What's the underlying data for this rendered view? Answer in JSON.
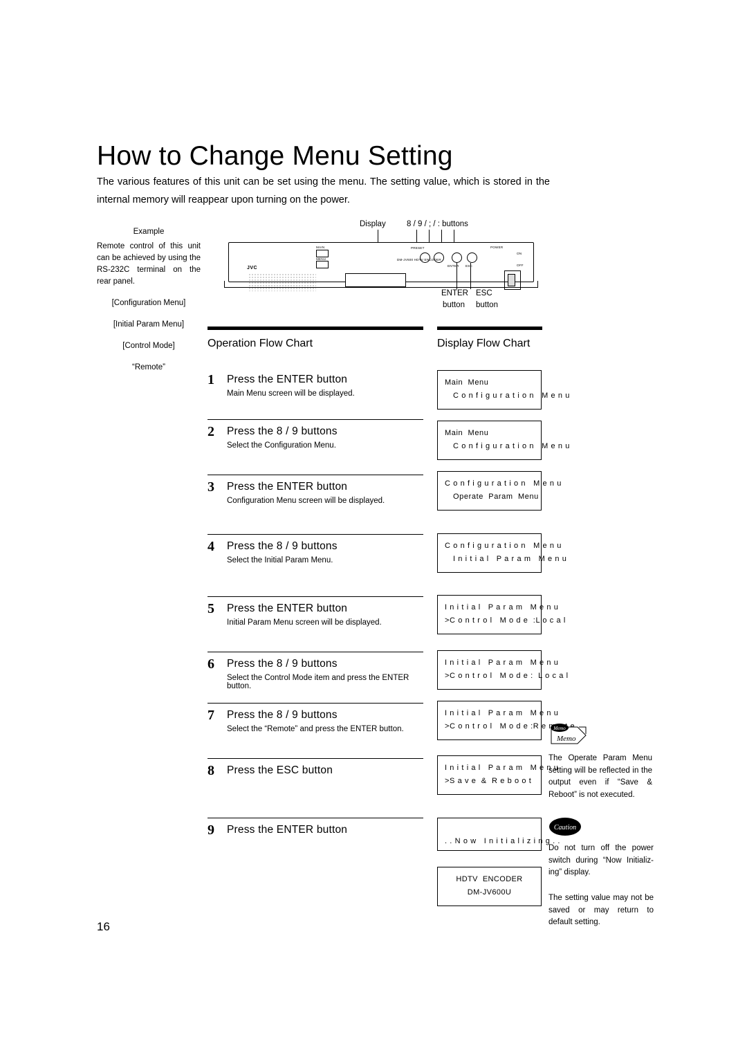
{
  "page": {
    "title": "How to Change Menu Setting",
    "intro": "The various features of this unit can be set using the menu. The setting value, which is stored in the internal memory will reappear upon turning on the power.",
    "page_number": "16"
  },
  "left_column": {
    "example_label": "Example",
    "paragraph": "Remote control of this unit can be achieved by using the RS-232C terminal on the rear panel.",
    "items": [
      "[Configuration Menu]",
      "[Initial Param Menu]",
      "[Control Mode]",
      "“Remote”"
    ]
  },
  "device": {
    "display_label": "Display",
    "buttons_label": "8 / 9 / ; / : buttons",
    "brand": "JVC",
    "model_line": "DM-JV600  HDTV  ENCODER",
    "power_label": "POWER",
    "power_on": "ON",
    "power_off": "OFF",
    "panel_marks": [
      "MAIN",
      "MENU",
      "PRESET",
      "ENTER",
      "ESC"
    ],
    "enter_label": "ENTER",
    "esc_label": "ESC",
    "button_word_left": "button",
    "button_word_right": "button"
  },
  "sections": {
    "operation": "Operation Flow Chart",
    "display": "Display Flow Chart"
  },
  "steps": [
    {
      "num": "1",
      "title": "Press the ENTER button",
      "desc": "Main Menu screen will be displayed."
    },
    {
      "num": "2",
      "title": "Press the 8 / 9  buttons",
      "desc": "Select the Configuration Menu."
    },
    {
      "num": "3",
      "title": "Press the ENTER button",
      "desc": "Configuration Menu screen will be displayed."
    },
    {
      "num": "4",
      "title": "Press the 8 / 9  buttons",
      "desc": "Select the Initial Param Menu."
    },
    {
      "num": "5",
      "title": "Press the ENTER button",
      "desc": "Initial Param Menu screen will be displayed."
    },
    {
      "num": "6",
      "title": "Press the 8 / 9  buttons",
      "desc": "Select the Control Mode item and press the ENTER button."
    },
    {
      "num": "7",
      "title": "Press the 8 / 9  buttons",
      "desc": "Select the “Remote” and press the ENTER button."
    },
    {
      "num": "8",
      "title": "Press the ESC button",
      "desc": ""
    },
    {
      "num": "9",
      "title": "Press the ENTER button",
      "desc": ""
    }
  ],
  "display_boxes": [
    {
      "line1": "Main  Menu",
      "line2": "C o n f i g u r a t i o n   M e n u"
    },
    {
      "line1": "Main  Menu",
      "line2": "C o n f i g u r a t i o n   M e n u"
    },
    {
      "line1": "C o n f i g u r a t i o n   M e n u",
      "line2": "Operate  Param  Menu"
    },
    {
      "line1": "C o n f i g u r a t i o n   M e n u",
      "line2": "I n i t i a l   P a r a m   M e n u"
    },
    {
      "line1": "I n i t i a l   P a r a m   M e n u",
      "line2": ">C o n t r o l   M o d e  :L o c a l"
    },
    {
      "line1": "I n i t i a l   P a r a m   M e n u",
      "line2": ">C o n t r o l   M o d e :  L o c a l"
    },
    {
      "line1": "I n i t i a l   P a r a m   M e n u",
      "line2": ">C o n t r o l   M o d e :R e m o t e"
    },
    {
      "line1": "I n i t i a l   P a r a m   M e n u",
      "line2": ">S a v e  &  R e b o o t"
    },
    {
      "line1": ". . N o w   I n i t i a l i z i n g . .",
      "line2": ""
    },
    {
      "line1": "HDTV  ENCODER",
      "line2": "DM-JV600U"
    }
  ],
  "memo": {
    "label": "Memo",
    "text": "The Operate Param Menu setting will be reflected in the output even if “Save & Reboot” is not executed."
  },
  "caution": {
    "label": "Caution",
    "text1": "Do not turn off the power switch during “Now Initializ-ing” display.",
    "text2": "The setting value may not be saved or may return to default setting."
  }
}
